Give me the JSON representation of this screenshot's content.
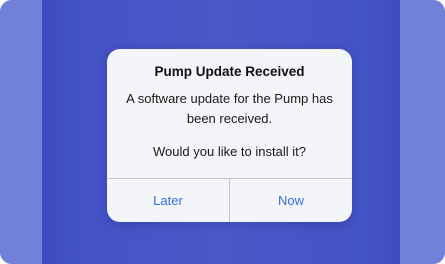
{
  "dialog": {
    "title": "Pump Update Received",
    "message": "A software update for the Pump has been received.",
    "question": "Would you like to install it?",
    "buttons": {
      "later": "Later",
      "now": "Now"
    }
  },
  "colors": {
    "accent": "#2f6ff0",
    "backdrop": "#4d5ed2",
    "backdrop_edge": "#7a89e3"
  }
}
